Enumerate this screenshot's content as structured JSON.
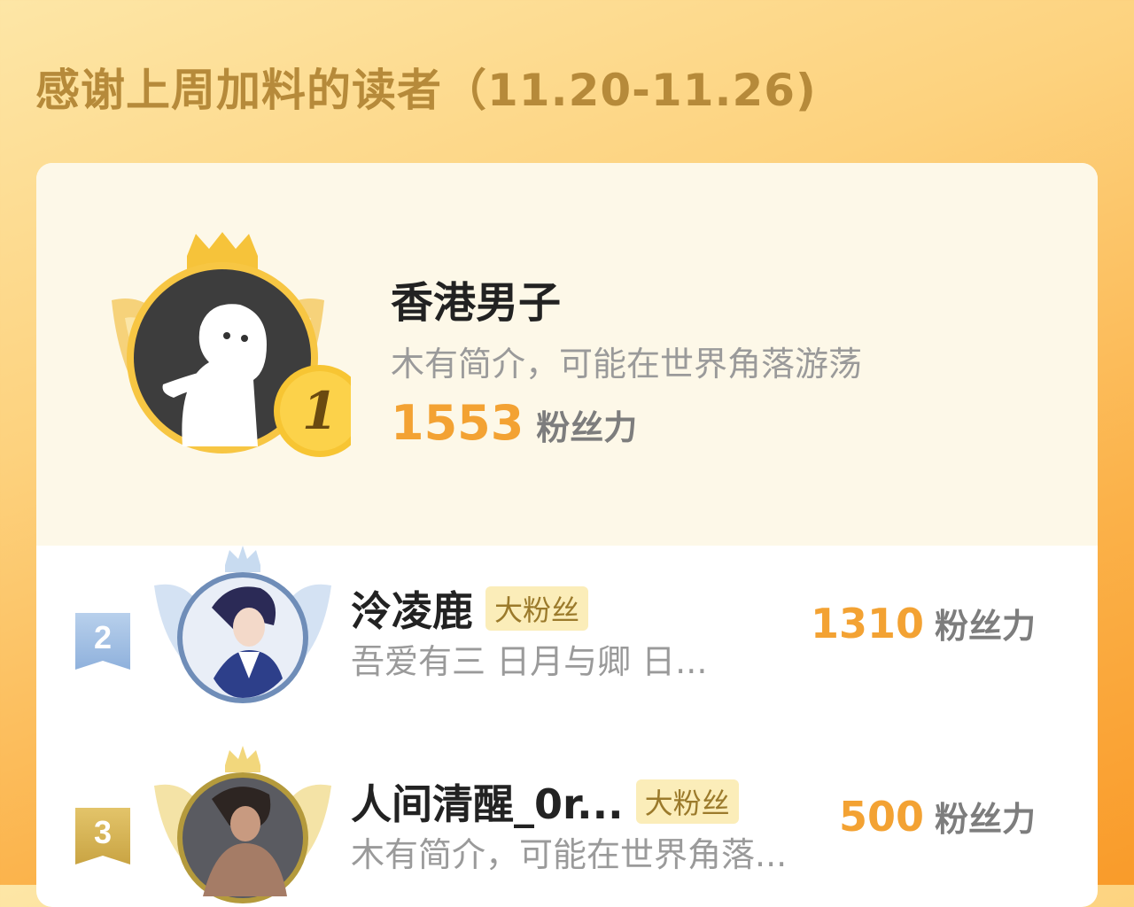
{
  "header": {
    "title": "感谢上周加料的读者（11.20-11.26)"
  },
  "top_reader": {
    "rank": "1",
    "name": "香港男子",
    "bio": "木有简介，可能在世界角落游荡",
    "score": "1553",
    "score_unit": "粉丝力"
  },
  "readers": [
    {
      "rank": "2",
      "name": "泠凌鹿",
      "badge": "大粉丝",
      "bio": "吾爱有三 日月与卿 日...",
      "score": "1310",
      "score_unit": "粉丝力"
    },
    {
      "rank": "3",
      "name": "人间清醒_0r...",
      "badge": "大粉丝",
      "bio": "木有简介，可能在世界角落...",
      "score": "500",
      "score_unit": "粉丝力"
    }
  ],
  "colors": {
    "accent": "#f3a233",
    "gold": "#f5c542",
    "silver": "#a9c3e3",
    "bronze": "#d9b85a"
  },
  "icons": {
    "crown": "crown-icon",
    "wings": "wings-icon",
    "rank_medal": "medal-icon",
    "rank_flag": "rank-flag-icon"
  }
}
